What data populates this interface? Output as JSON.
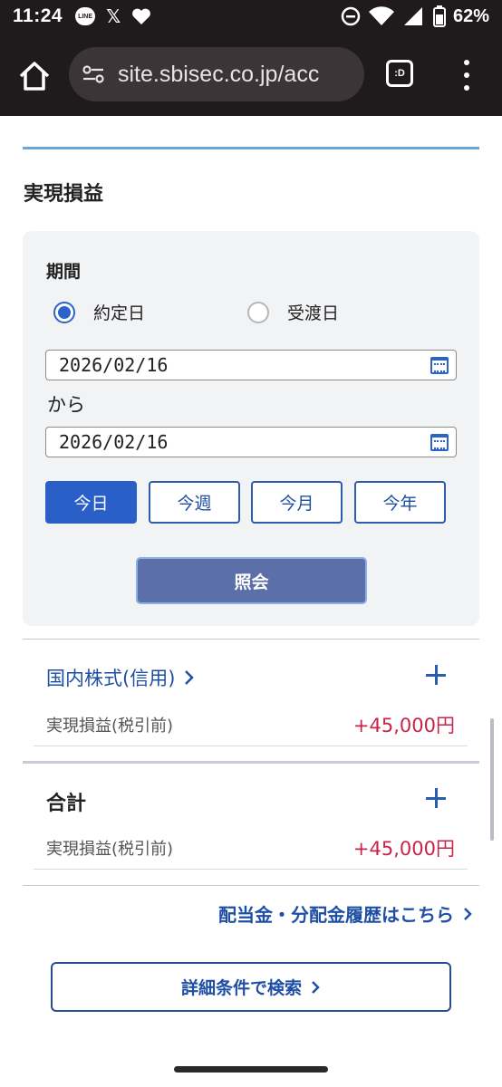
{
  "status_bar": {
    "time": "11:24",
    "battery": "62%",
    "icons": [
      "line-icon",
      "x-icon",
      "heart-icon",
      "dnd-icon",
      "wifi-icon",
      "signal-icon",
      "battery-icon"
    ]
  },
  "browser": {
    "url": "site.sbisec.co.jp/acc",
    "tabs_label": ":D"
  },
  "page": {
    "title": "実現損益"
  },
  "filter": {
    "period_label": "期間",
    "radio_contract": "約定日",
    "radio_delivery": "受渡日",
    "selected_radio": "約定日",
    "date_from": "2026/02/16",
    "kara": "から",
    "date_to": "2026/02/16",
    "quick_buttons": [
      "今日",
      "今週",
      "今月",
      "今年"
    ],
    "active_quick": "今日",
    "search_label": "照会"
  },
  "sections": [
    {
      "title": "国内株式(信用)",
      "row_label": "実現損益(税引前)",
      "row_value": "+45,000円"
    },
    {
      "title": "合計",
      "row_label": "実現損益(税引前)",
      "row_value": "+45,000円"
    }
  ],
  "links": {
    "dividend": "配当金・分配金履歴はこちら",
    "detail_search": "詳細条件で検索"
  },
  "colors": {
    "accent": "#2b5fc8",
    "positive": "#c8234a",
    "search_button": "#5d6fa8"
  }
}
